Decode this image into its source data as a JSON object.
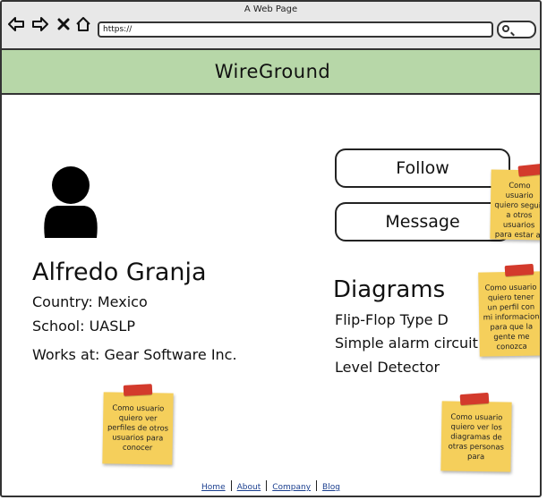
{
  "window": {
    "title": "A Web Page"
  },
  "browser": {
    "url": "https://"
  },
  "header": {
    "title": "WireGround"
  },
  "profile": {
    "name": "Alfredo Granja",
    "country": "Country: Mexico",
    "school": "School: UASLP",
    "works_at": "Works at: Gear Software Inc."
  },
  "actions": {
    "follow": "Follow",
    "message": "Message"
  },
  "diagrams": {
    "title": "Diagrams",
    "items": [
      "Flip-Flop Type D",
      "Simple alarm circuit",
      "Level Detector"
    ]
  },
  "notes": [
    "Como usuario quiero seguir a otros usuarios para estar al tanto de su trabajo",
    "Como usuario quiero tener un perfil con mi informacion para que la gente me conozca",
    "Como usuario quiero ver perfiles de otros usuarios para conocer",
    "Como usuario quiero ver los diagramas de otras personas para"
  ],
  "footer": {
    "links": [
      "Home",
      "About",
      "Company",
      "Blog"
    ]
  },
  "colors": {
    "header_bg": "#b7d7a8",
    "sticky": "#f5cf5b",
    "tape": "#d33a2c",
    "link": "#1b3f8f"
  }
}
